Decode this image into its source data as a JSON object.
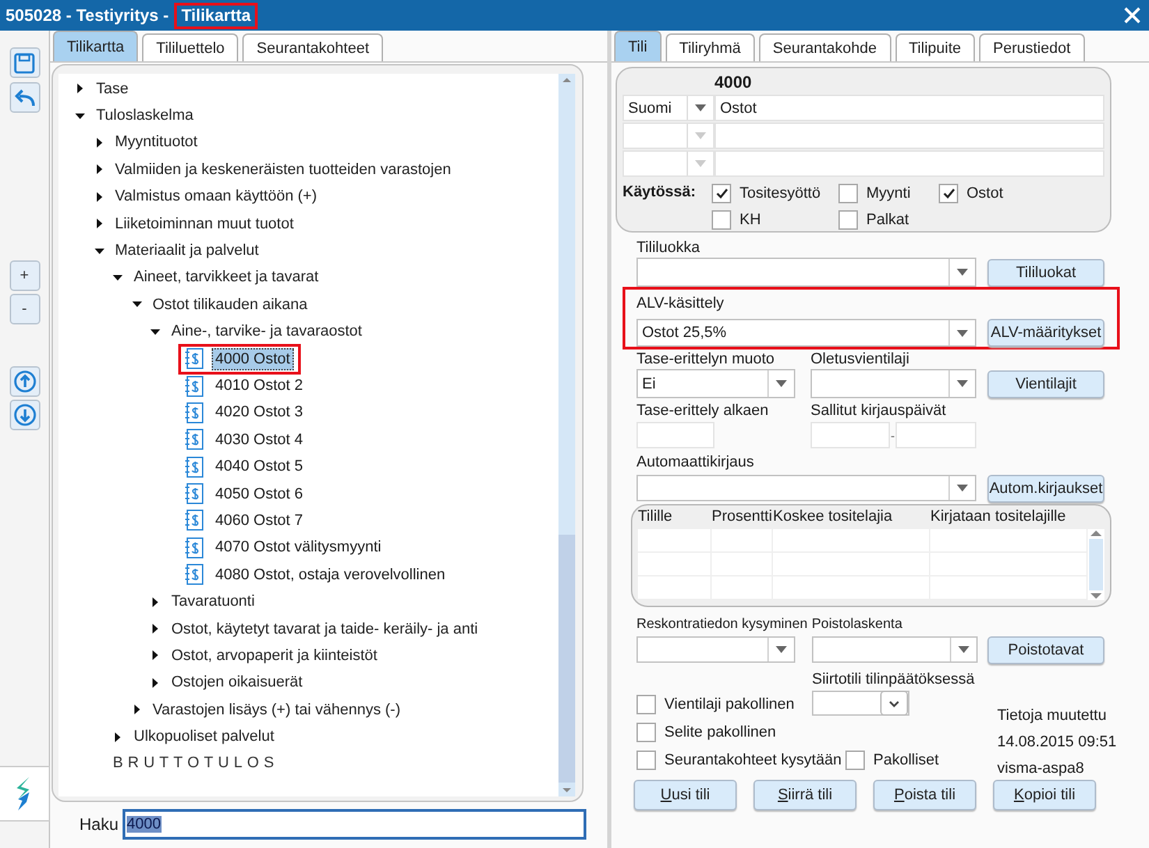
{
  "window": {
    "title": "505028 - Testiyritys -",
    "subtitle": "Tilikartta",
    "subtitle_marked": true
  },
  "toolbar": {
    "zoom_buttons": [
      "+",
      "-"
    ]
  },
  "tree_tabs": [
    {
      "label": "Tilikartta",
      "selected": true
    },
    {
      "label": "Tililuettelo",
      "selected": false
    },
    {
      "label": "Seurantakohteet",
      "selected": false
    }
  ],
  "tree": [
    {
      "kind": "group",
      "label": "Tase",
      "expanded": false
    },
    {
      "kind": "group",
      "label": "Tuloslaskelma",
      "expanded": true,
      "children": [
        {
          "kind": "group",
          "label": "Myyntituotot",
          "expanded": false
        },
        {
          "kind": "group",
          "label": "Valmiiden ja keskeneräisten tuotteiden varastojen",
          "expanded": false
        },
        {
          "kind": "group",
          "label": "Valmistus omaan käyttöön (+)",
          "expanded": false
        },
        {
          "kind": "group",
          "label": "Liiketoiminnan muut tuotot",
          "expanded": false
        },
        {
          "kind": "group",
          "label": "Materiaalit ja palvelut",
          "expanded": true,
          "children": [
            {
              "kind": "group",
              "label": "Aineet, tarvikkeet ja tavarat",
              "expanded": true,
              "children": [
                {
                  "kind": "group",
                  "label": "Ostot tilikauden aikana",
                  "expanded": true,
                  "children": [
                    {
                      "kind": "group",
                      "label": "Aine-, tarvike- ja tavaraostot",
                      "expanded": true,
                      "children": [
                        {
                          "kind": "account",
                          "label": "4000 Ostot",
                          "selected": true,
                          "marked": true
                        },
                        {
                          "kind": "account",
                          "label": "4010 Ostot 2",
                          "selected": false,
                          "marked": false
                        },
                        {
                          "kind": "account",
                          "label": "4020 Ostot 3",
                          "selected": false,
                          "marked": false
                        },
                        {
                          "kind": "account",
                          "label": "4030 Ostot 4",
                          "selected": false,
                          "marked": false
                        },
                        {
                          "kind": "account",
                          "label": "4040 Ostot 5",
                          "selected": false,
                          "marked": false
                        },
                        {
                          "kind": "account",
                          "label": "4050 Ostot 6",
                          "selected": false,
                          "marked": false
                        },
                        {
                          "kind": "account",
                          "label": "4060 Ostot 7",
                          "selected": false,
                          "marked": false
                        },
                        {
                          "kind": "account",
                          "label": "4070 Ostot välitysmyynti",
                          "selected": false,
                          "marked": false
                        },
                        {
                          "kind": "account",
                          "label": "4080 Ostot, ostaja verovelvollinen",
                          "selected": false,
                          "marked": false
                        }
                      ]
                    },
                    {
                      "kind": "group",
                      "label": "Tavaratuonti",
                      "expanded": false
                    },
                    {
                      "kind": "group",
                      "label": "Ostot, käytetyt tavarat ja taide- keräily- ja anti",
                      "expanded": false
                    },
                    {
                      "kind": "group",
                      "label": "Ostot, arvopaperit ja kiinteistöt",
                      "expanded": false
                    },
                    {
                      "kind": "group",
                      "label": "Ostojen oikaisuerät",
                      "expanded": false
                    }
                  ]
                },
                {
                  "kind": "group",
                  "label": "Varastojen lisäys (+) tai vähennys (-)",
                  "expanded": false
                }
              ]
            },
            {
              "kind": "group",
              "label": "Ulkopuoliset palvelut",
              "expanded": false
            },
            {
              "kind": "heading",
              "label": "BRUTTOTULOS"
            }
          ]
        }
      ]
    }
  ],
  "search": {
    "label": "Haku",
    "value": "4000"
  },
  "account_tabs": [
    {
      "label": "Tili",
      "selected": true
    },
    {
      "label": "Tiliryhmä",
      "selected": false
    },
    {
      "label": "Seurantakohde",
      "selected": false
    },
    {
      "label": "Tilipuite",
      "selected": false
    },
    {
      "label": "Perustiedot",
      "selected": false
    }
  ],
  "account": {
    "number": "4000",
    "name_rows": [
      {
        "language": "Suomi",
        "name": "Ostot",
        "disabled": false
      },
      {
        "disabled": true
      },
      {
        "disabled": true
      }
    ],
    "in_use": {
      "label": "Käytössä:",
      "options": [
        {
          "label": "Tositesyöttö",
          "checked": true
        },
        {
          "label": "Myynti",
          "checked": false
        },
        {
          "label": "Ostot",
          "checked": true
        },
        {
          "label": "KH",
          "checked": false
        },
        {
          "label": "Palkat",
          "checked": false
        }
      ]
    }
  },
  "account_class": {
    "label": "Tililuokka",
    "button": "Tililuokat"
  },
  "vat": {
    "label": "ALV-käsittely",
    "value": "Ostot 25,5%",
    "button": "ALV-määritykset",
    "marked": true
  },
  "balance_spec": {
    "label": "Tase-erittelyn muoto",
    "value": "Ei"
  },
  "default_entry_type": {
    "label": "Oletusvientilaji",
    "button": "Vientilajit"
  },
  "balance_spec_start": {
    "label": "Tase-erittely alkaen"
  },
  "allowed_dates": {
    "label": "Sallitut kirjauspäivät",
    "separator": "-"
  },
  "auto_posting": {
    "label": "Automaattikirjaus",
    "button": "Autom.kirjaukset"
  },
  "auto_table": {
    "columns": [
      "Tilille",
      "Prosentti",
      "Koskee tositelajia",
      "Kirjataan tositelajille"
    ]
  },
  "ledger_query": {
    "label": "Reskontratiedon kysyminen"
  },
  "depreciation": {
    "label": "Poistolaskenta",
    "button": "Poistotavat"
  },
  "flags": [
    {
      "label": "Vientilaji pakollinen",
      "checked": false
    },
    {
      "label": "Selite pakollinen",
      "checked": false
    },
    {
      "label": "Seurantakohteet kysytään",
      "checked": false
    },
    {
      "label": "Pakolliset",
      "checked": false
    }
  ],
  "transfer_account": {
    "label": "Siirtotili tilinpäätöksessä"
  },
  "modified": {
    "label": "Tietoja muutettu",
    "time": "14.08.2015 09:51",
    "user": "visma-aspa8"
  },
  "actions": [
    "Uusi tili",
    "Siirrä tili",
    "Poista tili",
    "Kopioi tili"
  ]
}
